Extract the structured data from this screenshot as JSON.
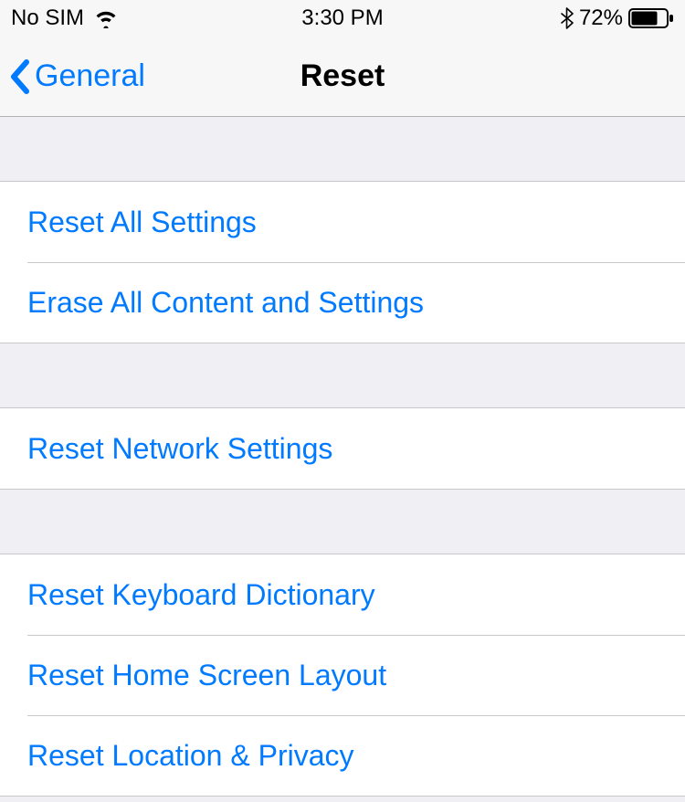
{
  "status_bar": {
    "carrier": "No SIM",
    "time": "3:30 PM",
    "battery_pct": "72%"
  },
  "nav": {
    "back_label": "General",
    "title": "Reset"
  },
  "groups": [
    {
      "items": [
        {
          "id": "reset-all-settings",
          "label": "Reset All Settings"
        },
        {
          "id": "erase-all-content-settings",
          "label": "Erase All Content and Settings"
        }
      ]
    },
    {
      "items": [
        {
          "id": "reset-network-settings",
          "label": "Reset Network Settings"
        }
      ]
    },
    {
      "items": [
        {
          "id": "reset-keyboard-dictionary",
          "label": "Reset Keyboard Dictionary"
        },
        {
          "id": "reset-home-screen-layout",
          "label": "Reset Home Screen Layout"
        },
        {
          "id": "reset-location-privacy",
          "label": "Reset Location & Privacy"
        }
      ]
    }
  ]
}
